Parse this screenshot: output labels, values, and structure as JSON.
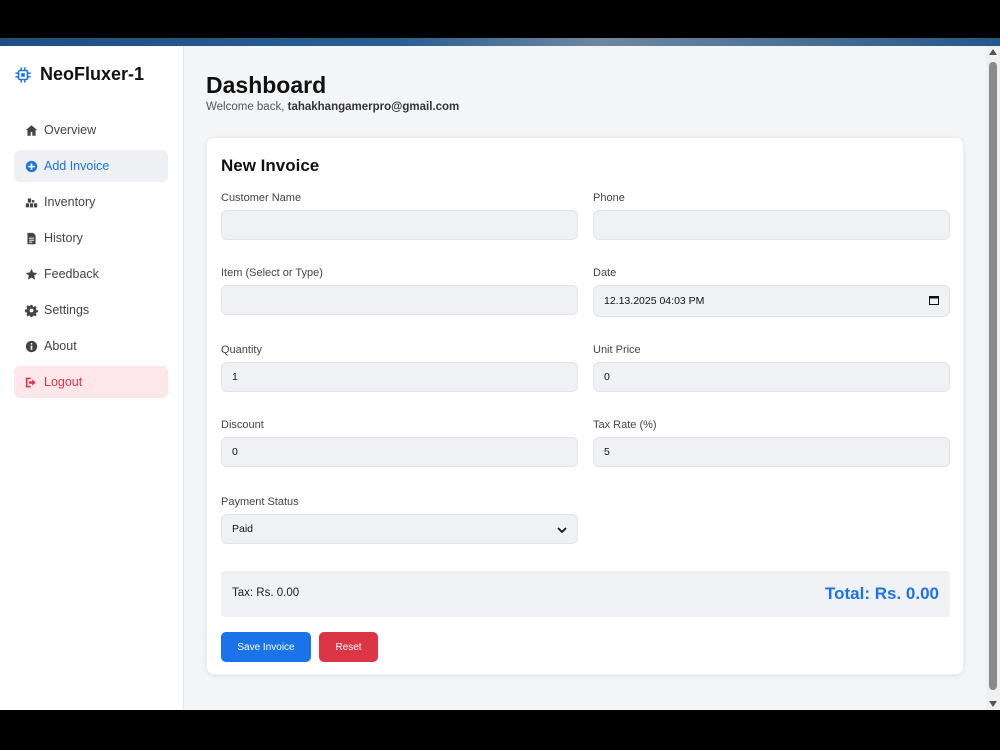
{
  "brand": {
    "name": "NeoFluxer-1",
    "icon": "chip-icon"
  },
  "sidebar": {
    "items": [
      {
        "label": "Overview",
        "icon": "home-icon"
      },
      {
        "label": "Add Invoice",
        "icon": "plus-circle-icon"
      },
      {
        "label": "Inventory",
        "icon": "boxes-icon"
      },
      {
        "label": "History",
        "icon": "file-icon"
      },
      {
        "label": "Feedback",
        "icon": "star-icon"
      },
      {
        "label": "Settings",
        "icon": "gear-icon"
      },
      {
        "label": "About",
        "icon": "info-icon"
      },
      {
        "label": "Logout",
        "icon": "logout-icon"
      }
    ],
    "active_index": 1
  },
  "header": {
    "title": "Dashboard",
    "welcome_prefix": "Welcome back,",
    "user_email": "tahakhangamerpro@gmail.com"
  },
  "form": {
    "title": "New Invoice",
    "customer_name": {
      "label": "Customer Name",
      "value": ""
    },
    "phone": {
      "label": "Phone",
      "value": ""
    },
    "item": {
      "label": "Item (Select or Type)",
      "value": ""
    },
    "date": {
      "label": "Date",
      "value": "12.13.2025 04:03 PM"
    },
    "quantity": {
      "label": "Quantity",
      "value": "1"
    },
    "unit_price": {
      "label": "Unit Price",
      "value": "0"
    },
    "discount": {
      "label": "Discount",
      "value": "0"
    },
    "tax_rate": {
      "label": "Tax Rate (%)",
      "value": "5"
    },
    "payment_status": {
      "label": "Payment Status",
      "value": "Paid"
    }
  },
  "totals": {
    "tax": "Tax: Rs. 0.00",
    "total": "Total: Rs. 0.00"
  },
  "buttons": {
    "save": "Save Invoice",
    "reset": "Reset"
  },
  "colors": {
    "accent": "#1a73e8",
    "danger": "#dc3545",
    "danger_bg": "#fde7ea"
  }
}
